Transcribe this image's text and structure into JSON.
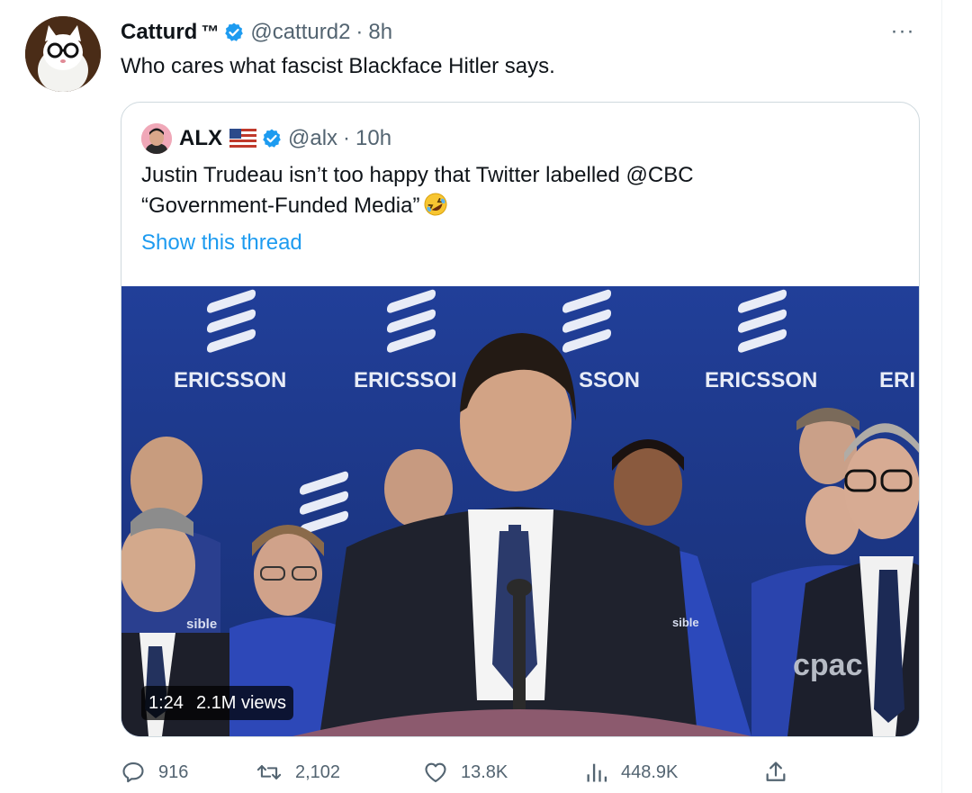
{
  "tweet": {
    "display_name": "Catturd",
    "tm": "™",
    "handle": "@catturd2",
    "separator": "·",
    "time": "8h",
    "text": "Who cares what fascist Blackface Hitler says.",
    "more_label": "···"
  },
  "quoted": {
    "display_name": "ALX",
    "handle": "@alx",
    "separator": "·",
    "time": "10h",
    "text_line1": "Justin Trudeau isn’t too happy that Twitter labelled @CBC",
    "text_line2": "“Government-Funded Media”",
    "show_thread": "Show this thread",
    "video": {
      "duration": "1:24",
      "views": "2.1M views",
      "backdrop_brand": "ERICSSON",
      "backdrop_partial_1": "ERICSSOI",
      "backdrop_partial_2": "SSON",
      "backdrop_partial_3": "ERI",
      "broadcaster_watermark": "cpac",
      "shirt_text": "sible"
    }
  },
  "actions": {
    "replies": "916",
    "retweets": "2,102",
    "likes": "13.8K",
    "views": "448.9K"
  },
  "colors": {
    "verified_blue": "#1d9bf0",
    "link_blue": "#1d9bf0",
    "muted_text": "#536471",
    "backdrop_blue": "#1d3a8f"
  },
  "icons": {
    "reply": "reply-icon",
    "retweet": "retweet-icon",
    "like": "heart-icon",
    "views": "bar-chart-icon",
    "share": "share-icon",
    "verified": "verified-badge-icon",
    "flag": "us-flag-icon",
    "emoji": "rolling-laughing-emoji-icon"
  }
}
